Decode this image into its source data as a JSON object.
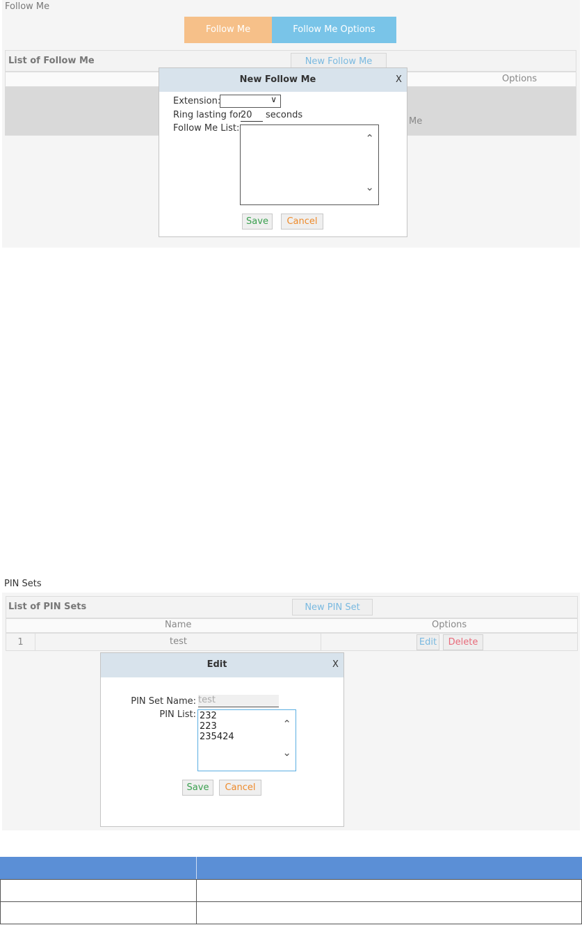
{
  "follow_me": {
    "section_title": "Follow Me",
    "tabs": [
      "Follow Me",
      "Follow Me Options"
    ],
    "list_title": "List of Follow Me",
    "new_button": "New Follow Me",
    "table_header_options": "Options",
    "row_partial_text": "Me",
    "dialog": {
      "title": "New Follow Me",
      "close": "X",
      "extension_label": "Extension:",
      "extension_value": "",
      "ring_label": "Ring lasting for",
      "ring_value": "20",
      "seconds_label": "seconds",
      "list_label": "Follow Me List:",
      "save": "Save",
      "cancel": "Cancel"
    }
  },
  "pin_sets": {
    "section_title": "PIN Sets",
    "list_title": "List of PIN Sets",
    "new_button": "New PIN Set",
    "columns": [
      "Name",
      "Options"
    ],
    "row": {
      "index": "1",
      "name": "test",
      "edit": "Edit",
      "delete": "Delete"
    },
    "dialog": {
      "title": "Edit",
      "close": "X",
      "name_label": "PIN Set Name:",
      "name_value": "test",
      "list_label": "PIN List:",
      "pins": [
        "232",
        "223",
        "235424"
      ],
      "save": "Save",
      "cancel": "Cancel"
    }
  },
  "colors": {
    "tab_active": "#f6c089",
    "tab_inactive": "#79c4e8",
    "table_header": "#5b8fd6",
    "save_text": "#3aa04f",
    "cancel_text": "#ee8a2a",
    "delete_text": "#e86a7a"
  }
}
